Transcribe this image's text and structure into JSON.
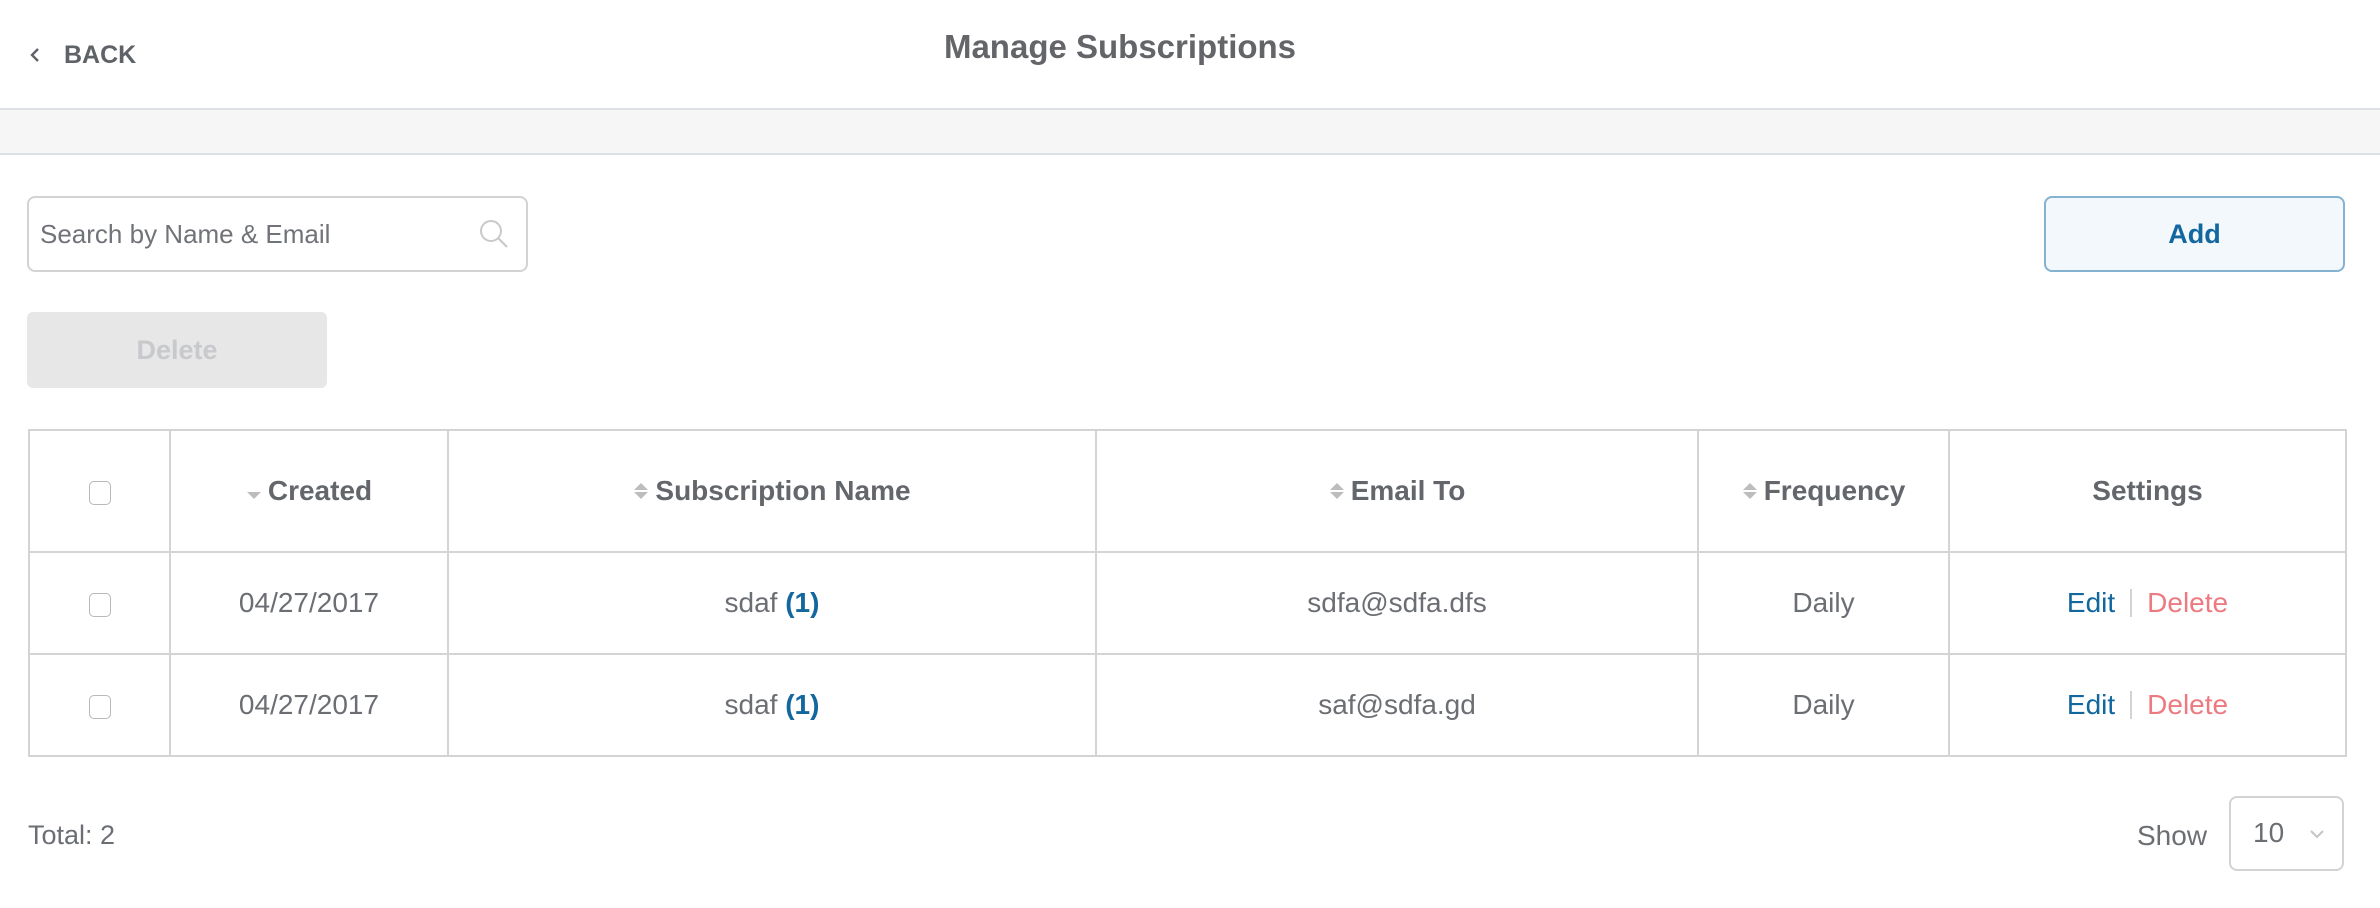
{
  "header": {
    "back_label": "BACK",
    "back_icon": "chevron-left-icon",
    "title": "Manage Subscriptions"
  },
  "toolbar": {
    "search_placeholder": "Search by Name & Email",
    "search_value": "",
    "search_icon": "search-icon",
    "add_label": "Add",
    "delete_label": "Delete",
    "delete_disabled": true
  },
  "table": {
    "columns": [
      {
        "key": "select",
        "label": ""
      },
      {
        "key": "created",
        "label": "Created",
        "sort": "descending"
      },
      {
        "key": "name",
        "label": "Subscription Name",
        "sort": "none"
      },
      {
        "key": "email",
        "label": "Email To",
        "sort": "none"
      },
      {
        "key": "frequency",
        "label": "Frequency",
        "sort": "none"
      },
      {
        "key": "settings",
        "label": "Settings"
      }
    ],
    "rows": [
      {
        "checked": false,
        "created": "04/27/2017",
        "name": "sdaf",
        "count": "(1)",
        "email": "sdfa@sdfa.dfs",
        "frequency": "Daily",
        "edit_label": "Edit",
        "delete_label": "Delete"
      },
      {
        "checked": false,
        "created": "04/27/2017",
        "name": "sdaf",
        "count": "(1)",
        "email": "saf@sdfa.gd",
        "frequency": "Daily",
        "edit_label": "Edit",
        "delete_label": "Delete"
      }
    ]
  },
  "footer": {
    "total_label": "Total: 2",
    "show_label": "Show",
    "page_size": "10"
  },
  "colors": {
    "accent": "#13679f",
    "danger": "#ec7a80",
    "text": "#6b6e73",
    "border": "#d4d4d4"
  }
}
